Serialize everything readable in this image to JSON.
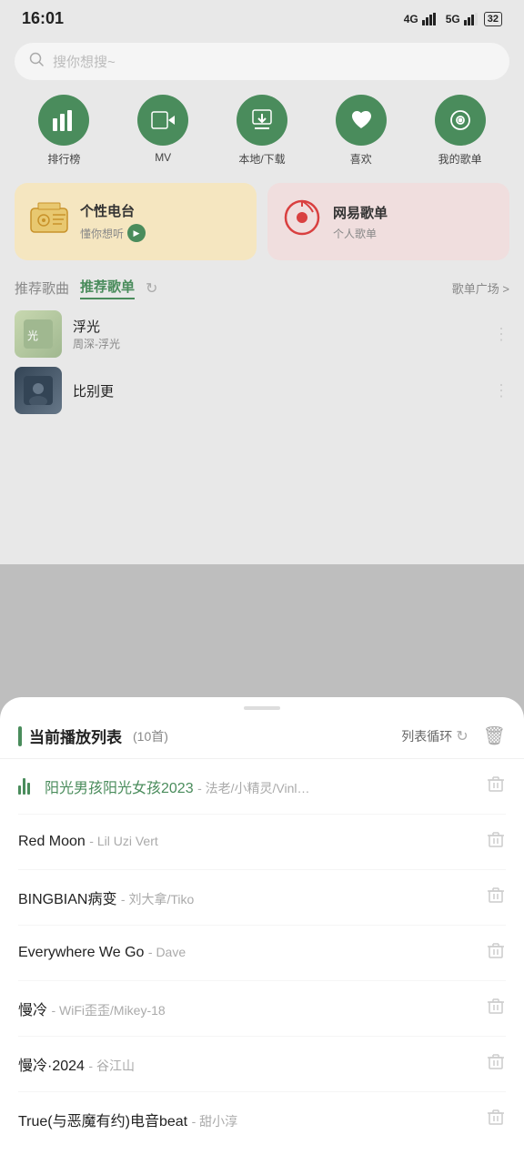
{
  "statusBar": {
    "time": "16:01",
    "signal": "4G 5G",
    "battery": "32"
  },
  "search": {
    "placeholder": "搜你想搜~"
  },
  "quickNav": [
    {
      "id": "rank",
      "label": "排行榜",
      "icon": "📊"
    },
    {
      "id": "mv",
      "label": "MV",
      "icon": "▶"
    },
    {
      "id": "download",
      "label": "本地/下载",
      "icon": "⬇"
    },
    {
      "id": "like",
      "label": "喜欢",
      "icon": "♥"
    },
    {
      "id": "mylist",
      "label": "我的歌单",
      "icon": "◎"
    }
  ],
  "cards": {
    "left": {
      "title": "个性电台",
      "subtitle": "懂你想听"
    },
    "right": {
      "title": "网易歌单",
      "subtitle": "个人歌单"
    }
  },
  "tabs": [
    {
      "id": "recommend_songs",
      "label": "推荐歌曲",
      "active": false
    },
    {
      "id": "recommend_list",
      "label": "推荐歌单",
      "active": true
    }
  ],
  "tabRight": "歌单广场 >",
  "songs": [
    {
      "title": "浮光",
      "artist": "周深-浮光",
      "thumbColor": "#c8d8b0"
    },
    {
      "title": "...",
      "artist": "...",
      "thumbColor": "#334455"
    }
  ],
  "sheet": {
    "title": "当前播放列表",
    "count": "(10首)",
    "loopLabel": "列表循环",
    "playlist": [
      {
        "id": "song1",
        "title": "阳光男孩阳光女孩2023",
        "artist": "法老/小精灵/Vinl…",
        "playing": true
      },
      {
        "id": "song2",
        "title": "Red Moon",
        "artist": "Lil Uzi Vert",
        "playing": false
      },
      {
        "id": "song3",
        "title": "BINGBIAN病变",
        "artist": "刘大拿/Tiko",
        "playing": false
      },
      {
        "id": "song4",
        "title": "Everywhere We Go",
        "artist": "Dave",
        "playing": false
      },
      {
        "id": "song5",
        "title": "慢冷",
        "artist": "WiFi歪歪/Mikey-18",
        "playing": false
      },
      {
        "id": "song6",
        "title": "慢冷·2024",
        "artist": "谷江山",
        "playing": false
      },
      {
        "id": "song7",
        "title": "True(与恶魔有约)电音beat",
        "artist": "甜小淳",
        "playing": false
      }
    ]
  }
}
